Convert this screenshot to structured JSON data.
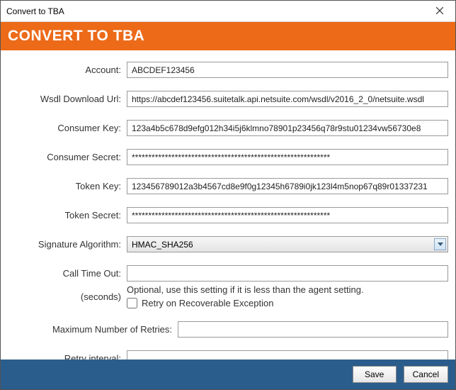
{
  "window": {
    "title": "Convert to TBA"
  },
  "banner": {
    "title": "CONVERT TO TBA"
  },
  "fields": {
    "account": {
      "label": "Account:",
      "value": "ABCDEF123456"
    },
    "wsdl": {
      "label": "Wsdl Download Url:",
      "value": "https://abcdef123456.suitetalk.api.netsuite.com/wsdl/v2016_2_0/netsuite.wsdl"
    },
    "consumerKey": {
      "label": "Consumer Key:",
      "value": "123a4b5c678d9efg012h34i5j6klmno78901p23456q78r9stu01234vw56730e8"
    },
    "consumerSecret": {
      "label": "Consumer Secret:",
      "value": "************************************************************"
    },
    "tokenKey": {
      "label": "Token Key:",
      "value": "123456789012a3b4567cd8e9f0g12345h6789i0jk123l4m5nop67q89r01337231"
    },
    "tokenSecret": {
      "label": "Token Secret:",
      "value": "************************************************************"
    },
    "sigAlg": {
      "label": "Signature Algorithm:",
      "selected": "HMAC_SHA256"
    },
    "callTimeOut": {
      "label": "Call Time Out:",
      "value": ""
    },
    "callTimeOutUnits": "(seconds)",
    "callTimeOutHint": "Optional, use this setting if it is less than the agent setting.",
    "retryCheckbox": {
      "label": "Retry on Recoverable Exception"
    },
    "maxRetries": {
      "label": "Maximum Number of Retries:",
      "value": ""
    },
    "retryInterval": {
      "label": "Retry interval:",
      "value": ""
    }
  },
  "footer": {
    "save": "Save",
    "cancel": "Cancel"
  }
}
